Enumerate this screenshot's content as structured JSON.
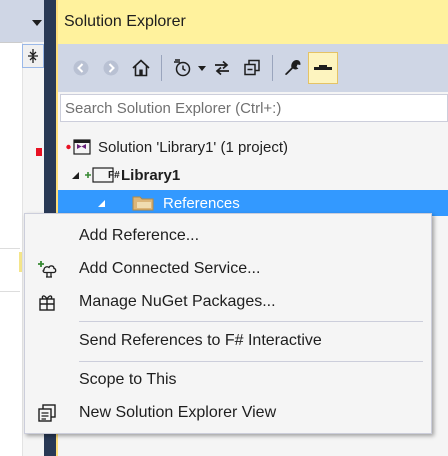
{
  "explorer": {
    "title": "Solution Explorer",
    "search_placeholder": "Search Solution Explorer (Ctrl+:)",
    "toolbar": [
      {
        "icon": "back-icon"
      },
      {
        "icon": "forward-icon"
      },
      {
        "icon": "home-icon"
      },
      {
        "icon": "pending-changes-icon"
      },
      {
        "icon": "sync-icon"
      },
      {
        "icon": "collapse-all-icon"
      },
      {
        "icon": "properties-icon"
      },
      {
        "icon": "preview-icon",
        "active": true
      }
    ],
    "tree": {
      "solution": "Solution 'Library1' (1 project)",
      "project": "Library1",
      "project_badge": "F#",
      "references": "References"
    }
  },
  "context_menu": {
    "items": [
      {
        "label": "Add Reference...",
        "icon": null
      },
      {
        "label": "Add Connected Service...",
        "icon": "connected-service-icon"
      },
      {
        "label": "Manage NuGet Packages...",
        "icon": "nuget-icon"
      },
      {
        "label": "Send References to F# Interactive",
        "icon": null
      },
      {
        "label": "Scope to This",
        "icon": null
      },
      {
        "label": "New Solution Explorer View",
        "icon": "new-view-icon"
      }
    ]
  },
  "colors": {
    "title_bg": "#fff29d",
    "toolbar_bg": "#cfd6e5",
    "selection": "#3399ff",
    "frame": "#293955"
  }
}
